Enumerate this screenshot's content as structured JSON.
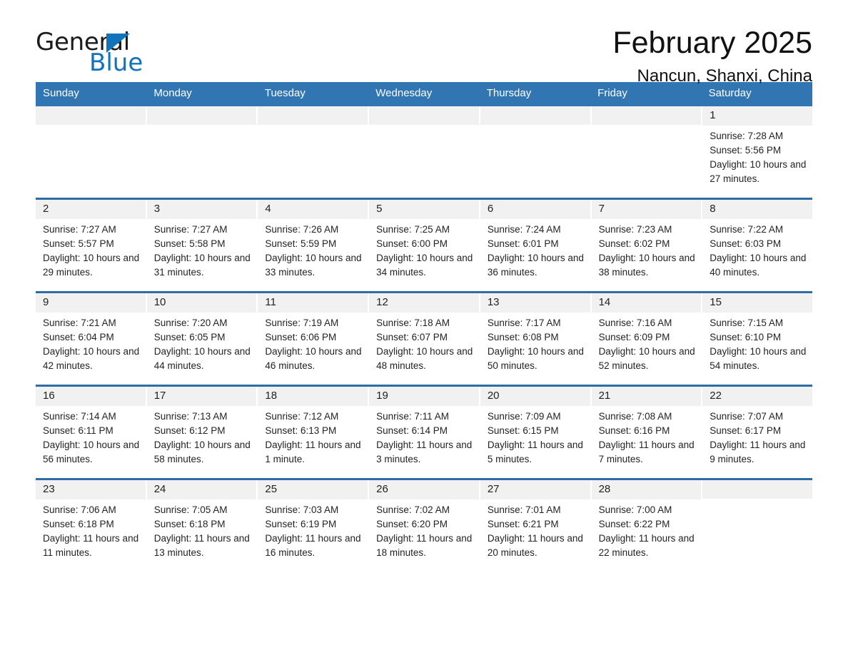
{
  "brand": {
    "name_part1": "General",
    "name_part2": "Blue",
    "accent_color": "#1273ba"
  },
  "header": {
    "title": "February 2025",
    "subtitle": "Nancun, Shanxi, China"
  },
  "theme": {
    "header_row_color": "#3275b3",
    "week_divider_color": "#2e6da4",
    "day_number_band_color": "#f1f1f1"
  },
  "weekdays": [
    "Sunday",
    "Monday",
    "Tuesday",
    "Wednesday",
    "Thursday",
    "Friday",
    "Saturday"
  ],
  "labels": {
    "sunrise_prefix": "Sunrise:",
    "sunset_prefix": "Sunset:",
    "daylight_prefix": "Daylight:"
  },
  "weeks": [
    [
      {
        "day": "",
        "empty": true
      },
      {
        "day": "",
        "empty": true
      },
      {
        "day": "",
        "empty": true
      },
      {
        "day": "",
        "empty": true
      },
      {
        "day": "",
        "empty": true
      },
      {
        "day": "",
        "empty": true
      },
      {
        "day": "1",
        "sunrise": "Sunrise: 7:28 AM",
        "sunset": "Sunset: 5:56 PM",
        "daylight": "Daylight: 10 hours and 27 minutes."
      }
    ],
    [
      {
        "day": "2",
        "sunrise": "Sunrise: 7:27 AM",
        "sunset": "Sunset: 5:57 PM",
        "daylight": "Daylight: 10 hours and 29 minutes."
      },
      {
        "day": "3",
        "sunrise": "Sunrise: 7:27 AM",
        "sunset": "Sunset: 5:58 PM",
        "daylight": "Daylight: 10 hours and 31 minutes."
      },
      {
        "day": "4",
        "sunrise": "Sunrise: 7:26 AM",
        "sunset": "Sunset: 5:59 PM",
        "daylight": "Daylight: 10 hours and 33 minutes."
      },
      {
        "day": "5",
        "sunrise": "Sunrise: 7:25 AM",
        "sunset": "Sunset: 6:00 PM",
        "daylight": "Daylight: 10 hours and 34 minutes."
      },
      {
        "day": "6",
        "sunrise": "Sunrise: 7:24 AM",
        "sunset": "Sunset: 6:01 PM",
        "daylight": "Daylight: 10 hours and 36 minutes."
      },
      {
        "day": "7",
        "sunrise": "Sunrise: 7:23 AM",
        "sunset": "Sunset: 6:02 PM",
        "daylight": "Daylight: 10 hours and 38 minutes."
      },
      {
        "day": "8",
        "sunrise": "Sunrise: 7:22 AM",
        "sunset": "Sunset: 6:03 PM",
        "daylight": "Daylight: 10 hours and 40 minutes."
      }
    ],
    [
      {
        "day": "9",
        "sunrise": "Sunrise: 7:21 AM",
        "sunset": "Sunset: 6:04 PM",
        "daylight": "Daylight: 10 hours and 42 minutes."
      },
      {
        "day": "10",
        "sunrise": "Sunrise: 7:20 AM",
        "sunset": "Sunset: 6:05 PM",
        "daylight": "Daylight: 10 hours and 44 minutes."
      },
      {
        "day": "11",
        "sunrise": "Sunrise: 7:19 AM",
        "sunset": "Sunset: 6:06 PM",
        "daylight": "Daylight: 10 hours and 46 minutes."
      },
      {
        "day": "12",
        "sunrise": "Sunrise: 7:18 AM",
        "sunset": "Sunset: 6:07 PM",
        "daylight": "Daylight: 10 hours and 48 minutes."
      },
      {
        "day": "13",
        "sunrise": "Sunrise: 7:17 AM",
        "sunset": "Sunset: 6:08 PM",
        "daylight": "Daylight: 10 hours and 50 minutes."
      },
      {
        "day": "14",
        "sunrise": "Sunrise: 7:16 AM",
        "sunset": "Sunset: 6:09 PM",
        "daylight": "Daylight: 10 hours and 52 minutes."
      },
      {
        "day": "15",
        "sunrise": "Sunrise: 7:15 AM",
        "sunset": "Sunset: 6:10 PM",
        "daylight": "Daylight: 10 hours and 54 minutes."
      }
    ],
    [
      {
        "day": "16",
        "sunrise": "Sunrise: 7:14 AM",
        "sunset": "Sunset: 6:11 PM",
        "daylight": "Daylight: 10 hours and 56 minutes."
      },
      {
        "day": "17",
        "sunrise": "Sunrise: 7:13 AM",
        "sunset": "Sunset: 6:12 PM",
        "daylight": "Daylight: 10 hours and 58 minutes."
      },
      {
        "day": "18",
        "sunrise": "Sunrise: 7:12 AM",
        "sunset": "Sunset: 6:13 PM",
        "daylight": "Daylight: 11 hours and 1 minute."
      },
      {
        "day": "19",
        "sunrise": "Sunrise: 7:11 AM",
        "sunset": "Sunset: 6:14 PM",
        "daylight": "Daylight: 11 hours and 3 minutes."
      },
      {
        "day": "20",
        "sunrise": "Sunrise: 7:09 AM",
        "sunset": "Sunset: 6:15 PM",
        "daylight": "Daylight: 11 hours and 5 minutes."
      },
      {
        "day": "21",
        "sunrise": "Sunrise: 7:08 AM",
        "sunset": "Sunset: 6:16 PM",
        "daylight": "Daylight: 11 hours and 7 minutes."
      },
      {
        "day": "22",
        "sunrise": "Sunrise: 7:07 AM",
        "sunset": "Sunset: 6:17 PM",
        "daylight": "Daylight: 11 hours and 9 minutes."
      }
    ],
    [
      {
        "day": "23",
        "sunrise": "Sunrise: 7:06 AM",
        "sunset": "Sunset: 6:18 PM",
        "daylight": "Daylight: 11 hours and 11 minutes."
      },
      {
        "day": "24",
        "sunrise": "Sunrise: 7:05 AM",
        "sunset": "Sunset: 6:18 PM",
        "daylight": "Daylight: 11 hours and 13 minutes."
      },
      {
        "day": "25",
        "sunrise": "Sunrise: 7:03 AM",
        "sunset": "Sunset: 6:19 PM",
        "daylight": "Daylight: 11 hours and 16 minutes."
      },
      {
        "day": "26",
        "sunrise": "Sunrise: 7:02 AM",
        "sunset": "Sunset: 6:20 PM",
        "daylight": "Daylight: 11 hours and 18 minutes."
      },
      {
        "day": "27",
        "sunrise": "Sunrise: 7:01 AM",
        "sunset": "Sunset: 6:21 PM",
        "daylight": "Daylight: 11 hours and 20 minutes."
      },
      {
        "day": "28",
        "sunrise": "Sunrise: 7:00 AM",
        "sunset": "Sunset: 6:22 PM",
        "daylight": "Daylight: 11 hours and 22 minutes."
      },
      {
        "day": "",
        "empty": true
      }
    ]
  ]
}
